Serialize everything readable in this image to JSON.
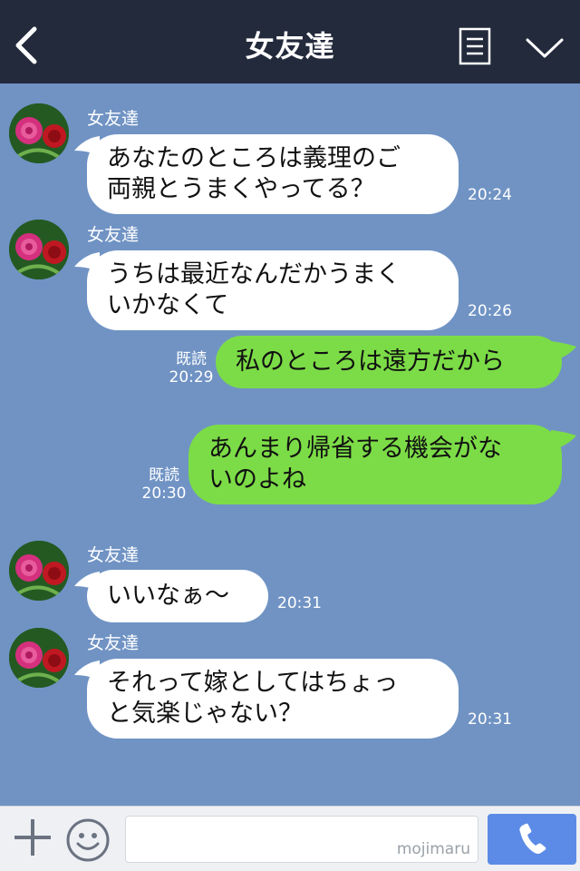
{
  "header": {
    "title": "女友達",
    "back_icon": "chevron-left-icon",
    "menu_icon": "memo-icon",
    "expand_icon": "chevron-down-icon",
    "background": "#232a3c"
  },
  "colors": {
    "chat_background": "#7093c4",
    "incoming_bubble": "#ffffff",
    "outgoing_bubble": "#7cdc47",
    "call_button": "#5b8be6"
  },
  "messages": [
    {
      "direction": "incoming",
      "sender": "女友達",
      "lines": [
        "あなたのところは義理のご",
        "両親とうまくやってる？"
      ],
      "time": "20:24"
    },
    {
      "direction": "incoming",
      "sender": "女友達",
      "lines": [
        "うちは最近なんだかうまく",
        "いかなくて"
      ],
      "time": "20:26"
    },
    {
      "direction": "outgoing",
      "lines": [
        "私のところは遠方だから"
      ],
      "read": "既読",
      "time": "20:29"
    },
    {
      "direction": "outgoing",
      "lines": [
        "あんまり帰省する機会がな",
        "いのよね"
      ],
      "read": "既読",
      "time": "20:30"
    },
    {
      "direction": "incoming",
      "sender": "女友達",
      "lines": [
        "いいなぁ〜"
      ],
      "time": "20:31"
    },
    {
      "direction": "incoming",
      "sender": "女友達",
      "lines": [
        "それって嫁としてはちょっ",
        "と気楽じゃない？"
      ],
      "time": "20:31"
    }
  ],
  "input": {
    "value": "",
    "watermark": "mojimaru",
    "plus_icon": "plus-icon",
    "emoji_icon": "smiley-icon",
    "call_icon": "phone-icon"
  }
}
